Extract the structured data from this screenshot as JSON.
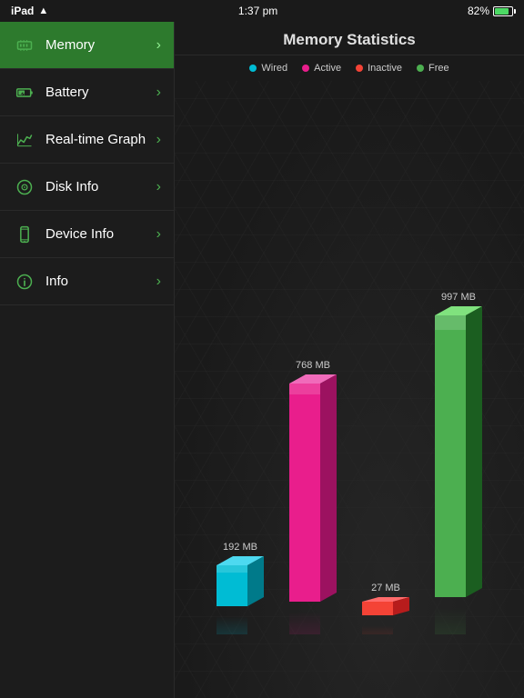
{
  "statusBar": {
    "device": "iPad",
    "time": "1:37 pm",
    "battery": "82%"
  },
  "sidebar": {
    "items": [
      {
        "id": "memory",
        "label": "Memory",
        "icon": "memory",
        "active": true
      },
      {
        "id": "battery",
        "label": "Battery",
        "icon": "battery",
        "active": false
      },
      {
        "id": "realtime",
        "label": "Real-time Graph",
        "icon": "graph",
        "active": false
      },
      {
        "id": "disk",
        "label": "Disk Info",
        "icon": "disk",
        "active": false
      },
      {
        "id": "device",
        "label": "Device Info",
        "icon": "device",
        "active": false
      },
      {
        "id": "info",
        "label": "Info",
        "icon": "info",
        "active": false
      }
    ]
  },
  "panel": {
    "title": "Memory Statistics",
    "legend": [
      {
        "id": "wired",
        "label": "Wired",
        "color": "#00bcd4"
      },
      {
        "id": "active",
        "label": "Active",
        "color": "#e91e8c"
      },
      {
        "id": "inactive",
        "label": "Inactive",
        "color": "#f44336"
      },
      {
        "id": "free",
        "label": "Free",
        "color": "#4caf50"
      }
    ],
    "bars": [
      {
        "id": "wired",
        "label": "192 MB",
        "value": 192,
        "color": "#00bcd4",
        "topColor": "#4dd9f0",
        "rightColor": "#007a8a"
      },
      {
        "id": "active",
        "label": "768 MB",
        "value": 768,
        "color": "#e91e8c",
        "topColor": "#f06bba",
        "rightColor": "#9c1260"
      },
      {
        "id": "inactive",
        "label": "27 MB",
        "value": 27,
        "color": "#f44336",
        "topColor": "#ff6b6b",
        "rightColor": "#b71c1c"
      },
      {
        "id": "free",
        "label": "997 MB",
        "value": 997,
        "color": "#4caf50",
        "topColor": "#80e27e",
        "rightColor": "#1b5e20"
      }
    ]
  }
}
